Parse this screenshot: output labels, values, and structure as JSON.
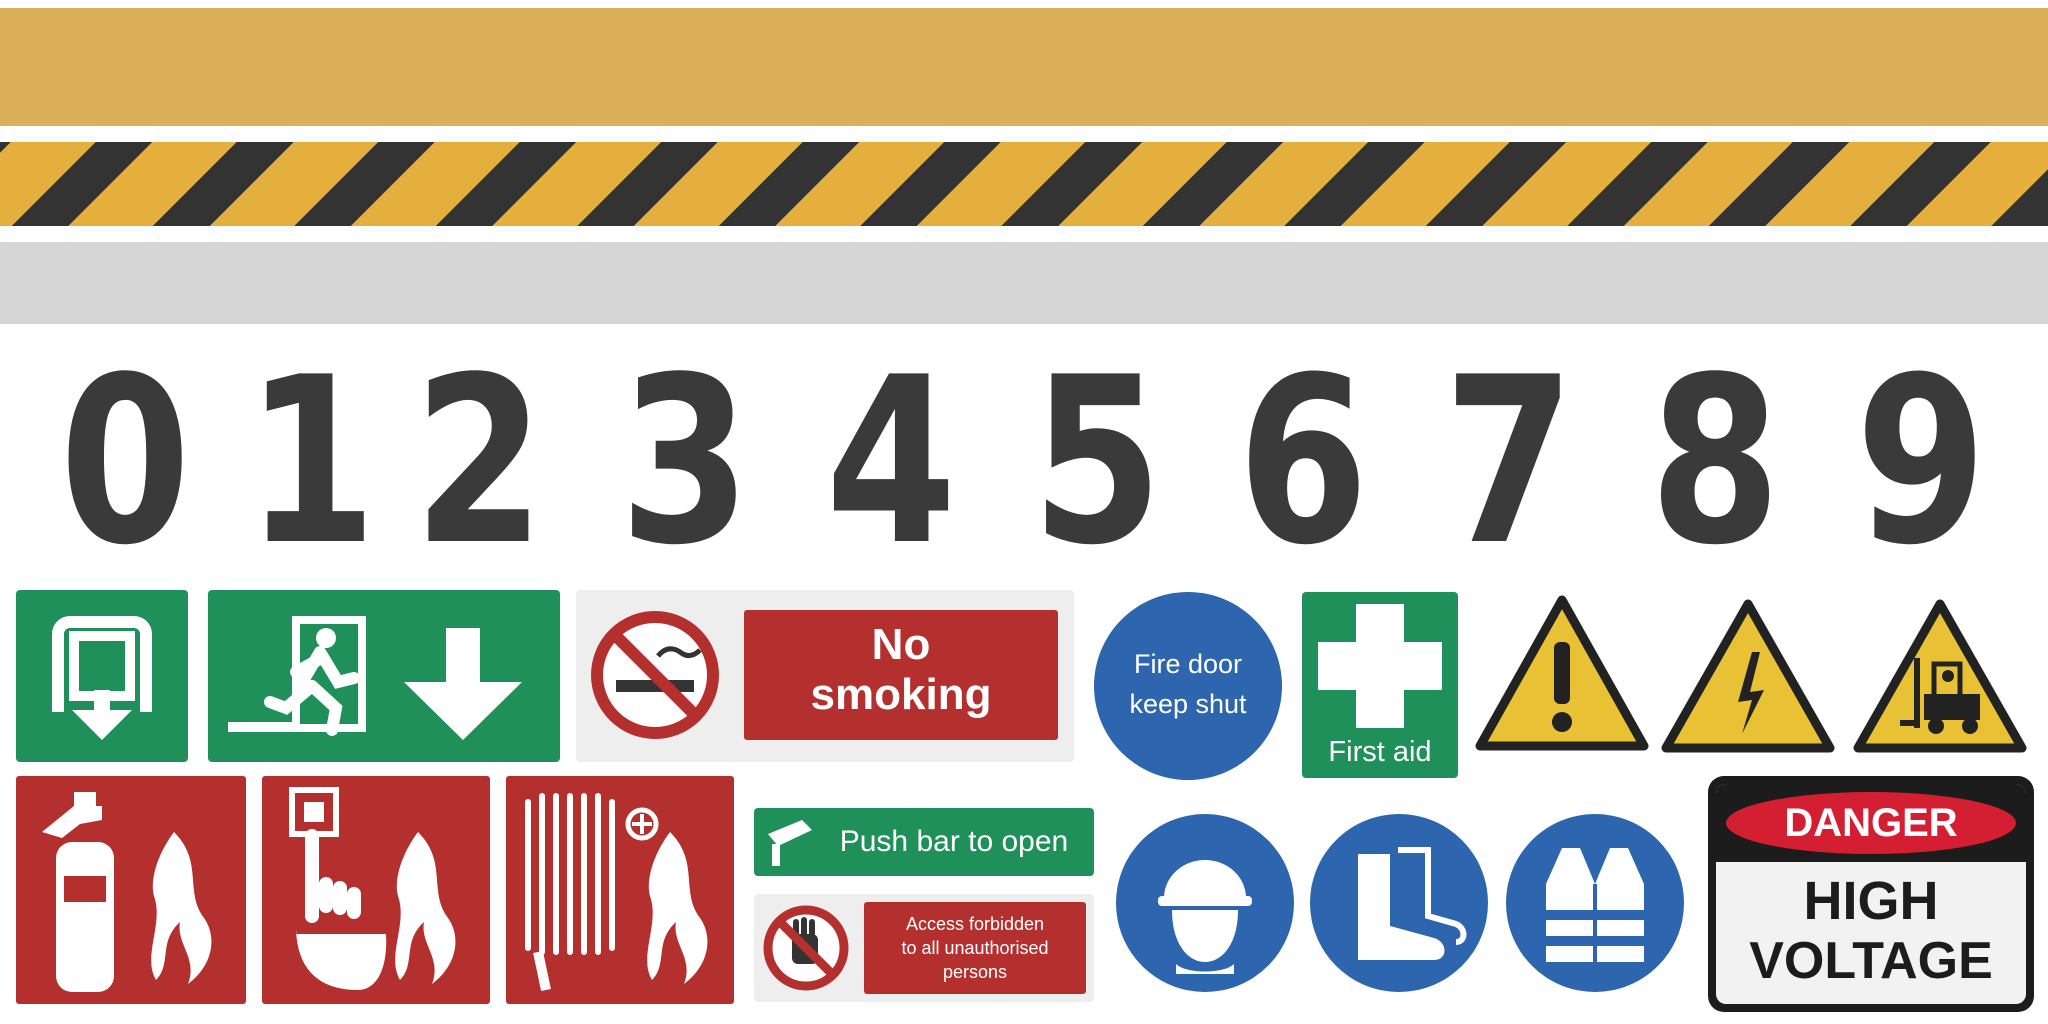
{
  "stripes": {
    "colors": {
      "yellow": "#dcb05a",
      "hazard_black": "#333333",
      "hazard_yellow": "#e4af3c",
      "grey": "#d6d6d6"
    }
  },
  "digits": [
    "0",
    "1",
    "2",
    "3",
    "4",
    "5",
    "6",
    "7",
    "8",
    "9"
  ],
  "signs": {
    "no_smoking": "No smoking",
    "no_smoking_line1": "No",
    "no_smoking_line2": "smoking",
    "fire_door_line1": "Fire door",
    "fire_door_line2": "keep shut",
    "first_aid": "First aid",
    "push_bar": "Push bar to open",
    "access_line1": "Access forbidden",
    "access_line2": "to all unauthorised",
    "access_line3": "persons",
    "danger": "DANGER",
    "high": "HIGH",
    "voltage": "VOLTAGE"
  },
  "icons": [
    "emergency-exit-icon",
    "running-man-icon",
    "arrow-down-icon",
    "no-smoking-icon",
    "first-aid-cross-icon",
    "warning-exclamation-icon",
    "high-voltage-icon",
    "forklift-warning-icon",
    "fire-extinguisher-icon",
    "fire-alarm-call-point-icon",
    "fire-hose-reel-icon",
    "push-bar-icon",
    "no-entry-hand-icon",
    "hard-hat-icon",
    "safety-boots-icon",
    "hi-vis-vest-icon"
  ],
  "colors": {
    "safe_green": "#20905a",
    "fire_red": "#b4302f",
    "mandatory_blue": "#2d66ae",
    "warning_yellow": "#e8c234",
    "danger_red": "#d41f33"
  }
}
